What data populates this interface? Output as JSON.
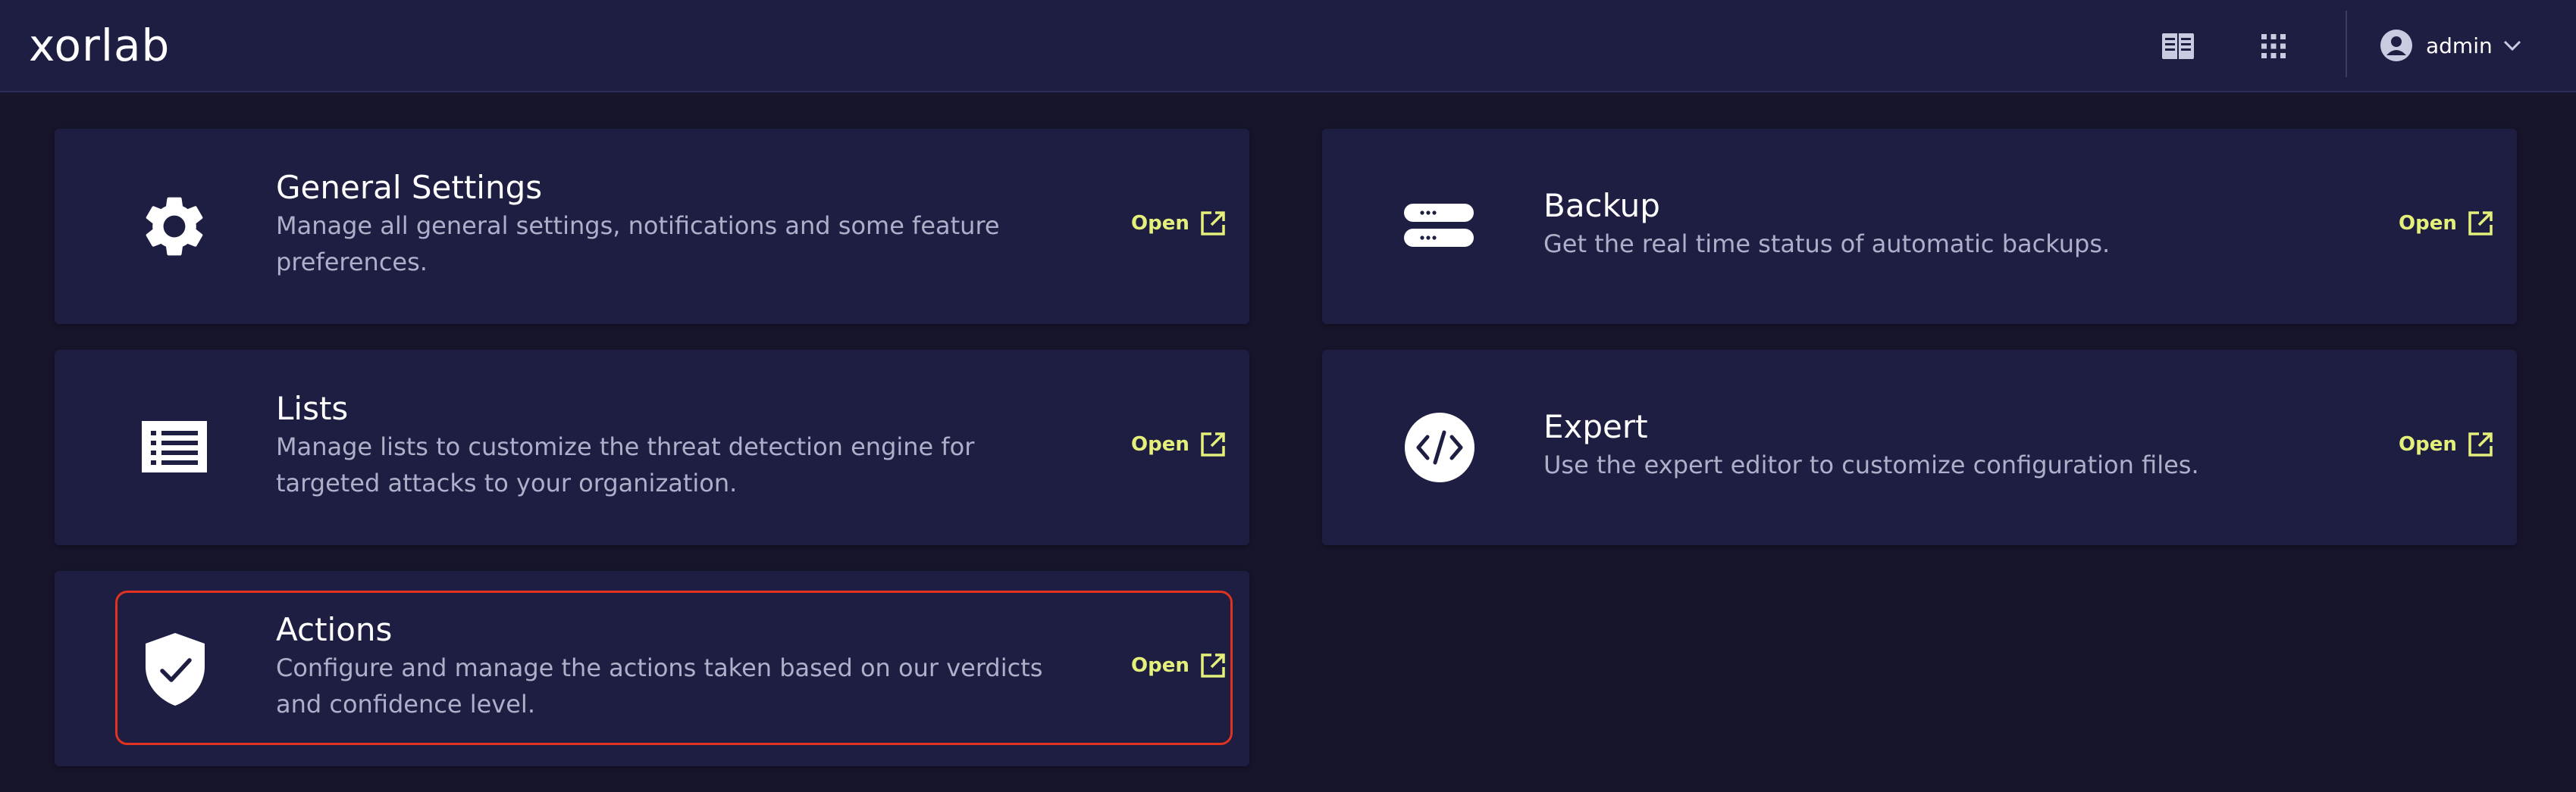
{
  "header": {
    "logo": "xorlab",
    "docs_icon": "book-open-icon",
    "apps_icon": "grid-icon",
    "user": {
      "avatar_icon": "user-circle-icon",
      "name": "admin",
      "chevron_icon": "chevron-down-icon"
    }
  },
  "cards": [
    {
      "id": "general-settings",
      "icon": "gear-icon",
      "title": "General Settings",
      "description": "Manage all general settings, notifications and some feature preferences.",
      "open_label": "Open"
    },
    {
      "id": "backup",
      "icon": "server-icon",
      "title": "Backup",
      "description": "Get the real time status of automatic backups.",
      "open_label": "Open"
    },
    {
      "id": "lists",
      "icon": "list-icon",
      "title": "Lists",
      "description": "Manage lists to customize the threat detection engine for targeted attacks to your organization.",
      "open_label": "Open"
    },
    {
      "id": "expert",
      "icon": "code-icon",
      "title": "Expert",
      "description": "Use the expert editor to customize configuration files.",
      "open_label": "Open"
    },
    {
      "id": "actions",
      "icon": "shield-check-icon",
      "title": "Actions",
      "description": "Configure and manage the actions taken based on our verdicts and confidence level.",
      "open_label": "Open",
      "highlighted": true
    }
  ],
  "colors": {
    "background": "#16152b",
    "card": "#1d1e42",
    "accent": "#e4f07a",
    "highlight": "#e0321f",
    "muted_text": "#aeb0c9"
  }
}
